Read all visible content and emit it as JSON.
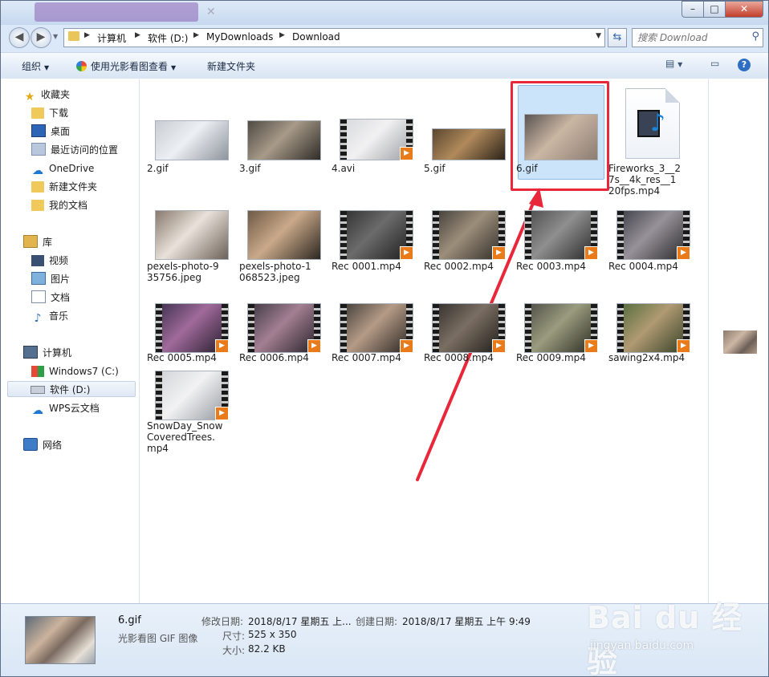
{
  "colors": {
    "accent": "#3366cc",
    "selection": "#cce4f9",
    "annotation": "#e8283a",
    "play_badge": "#ea7b1b"
  },
  "window": {
    "controls": {
      "minimize": "–",
      "maximize": "□",
      "close": "✕"
    }
  },
  "nav": {
    "back_icon": "back-arrow-icon",
    "forward_icon": "forward-arrow-icon"
  },
  "address": {
    "crumbs": [
      "计算机",
      "软件 (D:)",
      "MyDownloads",
      "Download"
    ],
    "separator": "▶"
  },
  "search": {
    "placeholder": "搜索 Download"
  },
  "toolbar": {
    "organize": "组织",
    "open_with": "使用光影看图查看",
    "new_folder": "新建文件夹"
  },
  "sidebar": {
    "favorites": {
      "label": "收藏夹",
      "items": [
        "下载",
        "桌面",
        "最近访问的位置",
        "OneDrive",
        "新建文件夹",
        "我的文档"
      ]
    },
    "libraries": {
      "label": "库",
      "items": [
        "视频",
        "图片",
        "文档",
        "音乐"
      ]
    },
    "computer": {
      "label": "计算机",
      "items": [
        "Windows7 (C:)",
        "软件 (D:)",
        "WPS云文档"
      ]
    },
    "network": {
      "label": "网络"
    }
  },
  "files": [
    {
      "name": "2.gif",
      "kind": "image"
    },
    {
      "name": "3.gif",
      "kind": "image"
    },
    {
      "name": "4.avi",
      "kind": "video"
    },
    {
      "name": "5.gif",
      "kind": "image"
    },
    {
      "name": "6.gif",
      "kind": "image",
      "selected": true
    },
    {
      "name": "Fireworks_3__27s__4k_res__120fps.mp4",
      "kind": "media-doc"
    },
    {
      "name": "pexels-photo-935756.jpeg",
      "kind": "image"
    },
    {
      "name": "pexels-photo-1068523.jpeg",
      "kind": "image"
    },
    {
      "name": "Rec 0001.mp4",
      "kind": "video"
    },
    {
      "name": "Rec 0002.mp4",
      "kind": "video"
    },
    {
      "name": "Rec 0003.mp4",
      "kind": "video"
    },
    {
      "name": "Rec 0004.mp4",
      "kind": "video"
    },
    {
      "name": "Rec 0005.mp4",
      "kind": "video"
    },
    {
      "name": "Rec 0006.mp4",
      "kind": "video"
    },
    {
      "name": "Rec 0007.mp4",
      "kind": "video"
    },
    {
      "name": "Rec 0008.mp4",
      "kind": "video"
    },
    {
      "name": "Rec 0009.mp4",
      "kind": "video"
    },
    {
      "name": "sawing2x4.mp4",
      "kind": "video"
    },
    {
      "name": "SnowDay_SnowCoveredTrees.mp4",
      "kind": "video"
    }
  ],
  "file_labels": [
    "2.gif",
    "3.gif",
    "4.avi",
    "5.gif",
    "6.gif",
    [
      "Fireworks_3__2",
      "7s__4k_res__1",
      "20fps.mp4"
    ],
    [
      "pexels-photo-9",
      "35756.jpeg"
    ],
    [
      "pexels-photo-1",
      "068523.jpeg"
    ],
    "Rec 0001.mp4",
    "Rec 0002.mp4",
    "Rec 0003.mp4",
    "Rec 0004.mp4",
    "Rec 0005.mp4",
    "Rec 0006.mp4",
    "Rec 0007.mp4",
    "Rec 0008.mp4",
    "Rec 0009.mp4",
    "sawing2x4.mp4",
    [
      "SnowDay_Snow",
      "CoveredTrees.",
      "mp4"
    ]
  ],
  "details": {
    "name": "6.gif",
    "type": "光影看图 GIF 图像",
    "modified_label": "修改日期:",
    "modified_value": "2018/8/17 星期五 上...",
    "created_label": "创建日期:",
    "created_value": "2018/8/17 星期五 上午 9:49",
    "size_dims_label": "尺寸:",
    "size_dims_value": "525 x 350",
    "filesize_label": "大小:",
    "filesize_value": "82.2 KB"
  },
  "watermark": {
    "brand": "Bai du 经验",
    "url": "jingyan.baidu.com"
  }
}
